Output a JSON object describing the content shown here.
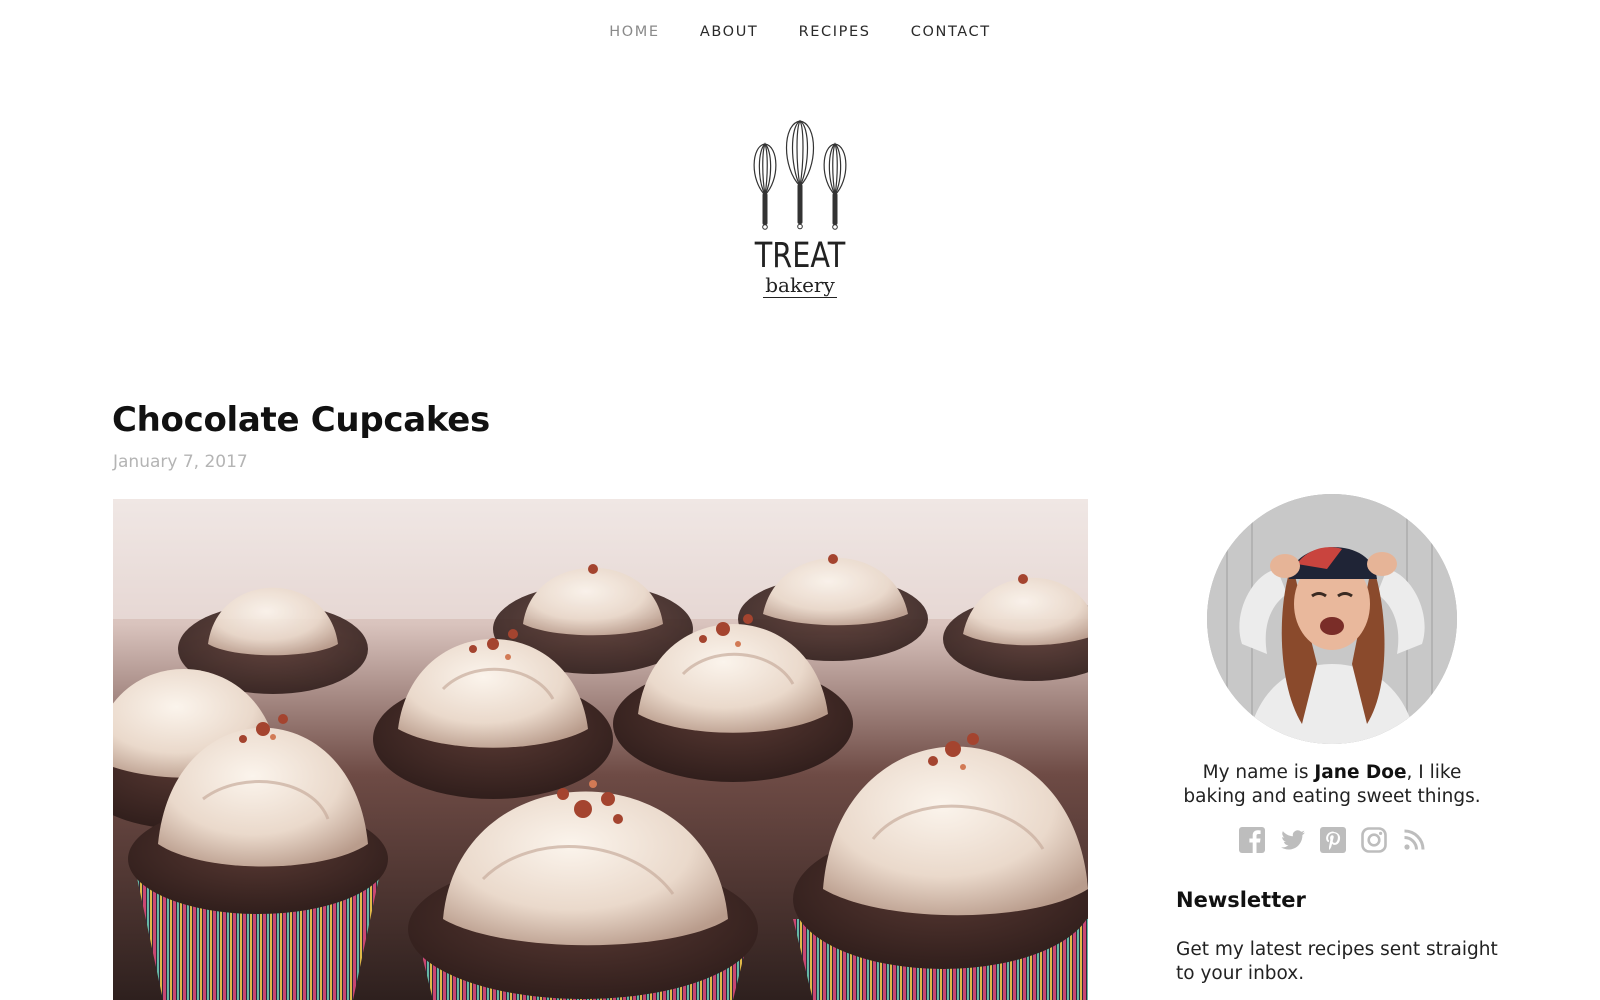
{
  "nav": {
    "items": [
      {
        "label": "HOME",
        "active": true
      },
      {
        "label": "ABOUT",
        "active": false
      },
      {
        "label": "RECIPES",
        "active": false
      },
      {
        "label": "CONTACT",
        "active": false
      }
    ]
  },
  "logo": {
    "line1": "TREAT",
    "line2": "bakery"
  },
  "post": {
    "title": "Chocolate Cupcakes",
    "date": "January 7, 2017"
  },
  "sidebar": {
    "bio": {
      "prefix": "My name is ",
      "name": "Jane Doe",
      "suffix": ", I like baking and eating sweet things."
    },
    "social_icons": [
      "facebook-icon",
      "twitter-icon",
      "pinterest-icon",
      "instagram-icon",
      "rss-icon"
    ],
    "newsletter": {
      "title": "Newsletter",
      "text": "Get my latest recipes sent straight to your inbox."
    }
  },
  "colors": {
    "text": "#111111",
    "nav_active": "#8a8a8a",
    "date": "#b4b4b4",
    "icon": "#bdbdbd"
  }
}
